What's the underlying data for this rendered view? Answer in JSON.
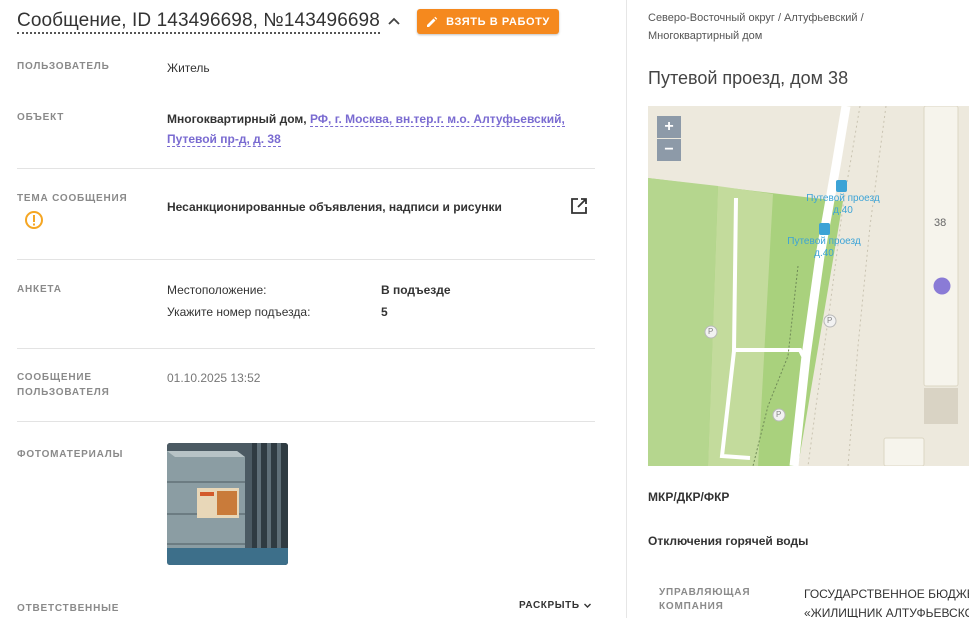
{
  "header": {
    "title": "Сообщение, ID 143496698, №143496698",
    "take_button": "ВЗЯТЬ В РАБОТУ"
  },
  "fields": {
    "user": {
      "label": "ПОЛЬЗОВАТЕЛЬ",
      "value": "Житель"
    },
    "object": {
      "label": "ОБЪЕКТ",
      "prefix": "Многоквартирный дом,",
      "address_line1": "РФ, г. Москва, вн.тер.г. м.о. Алтуфьевский,",
      "address_line2": "Путевой пр-д, д. 38"
    },
    "topic": {
      "label": "ТЕМА СООБЩЕНИЯ",
      "value": "Несанкционированные объявления, надписи и рисунки"
    },
    "form": {
      "label": "АНКЕТА",
      "rows": [
        {
          "key": "Местоположение:",
          "value": "В подъезде"
        },
        {
          "key": "Укажите номер подъезда:",
          "value": "5"
        }
      ]
    },
    "user_message": {
      "label_line1": "СООБЩЕНИЕ",
      "label_line2": "ПОЛЬЗОВАТЕЛЯ",
      "value": "01.10.2025 13:52"
    },
    "photos": {
      "label": "ФОТОМАТЕРИАЛЫ"
    },
    "responsible": {
      "label": "ОТВЕТСТВЕННЫЕ",
      "expand": "РАСКРЫТЬ"
    }
  },
  "right_panel": {
    "breadcrumb_line1": "Северо-Восточный округ / Алтуфьевский /",
    "breadcrumb_line2": "Многоквартирный дом",
    "address_title": "Путевой проезд, дом 38",
    "map": {
      "zoom_in": "+",
      "zoom_out": "−",
      "stop1_line1": "Путевой проезд",
      "stop1_line2": "д.40",
      "stop2_line1": "Путевой проезд",
      "stop2_line2": "д.40",
      "house_number": "38",
      "parking": "P"
    },
    "section1": "МКР/ДКР/ФКР",
    "section2": "Отключения горячей воды",
    "mgmt_label_line1": "УПРАВЛЯЮЩАЯ",
    "mgmt_label_line2": "КОМПАНИЯ",
    "mgmt_value_line1": "ГОСУДАРСТВЕННОЕ БЮДЖЕ",
    "mgmt_value_line2": "«ЖИЛИЩНИК АЛТУФЬЕВСКО"
  },
  "colors": {
    "accent": "#f5891e",
    "link": "#7a6bd1",
    "warning": "#f5a623",
    "map_marker": "#8a7bd6"
  }
}
